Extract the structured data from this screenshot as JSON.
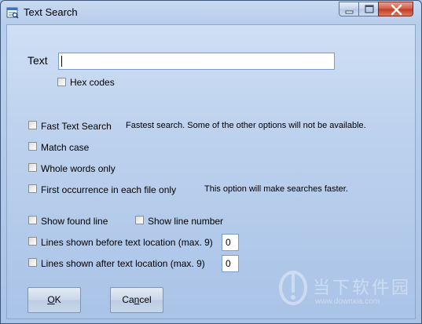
{
  "window": {
    "title": "Text Search",
    "controls": {
      "minimize_icon": "minimize-icon",
      "maximize_icon": "maximize-icon",
      "close_icon": "close-icon"
    },
    "close_color": "#c13b22"
  },
  "search": {
    "label": "Text",
    "value": "",
    "hex_codes": {
      "label": "Hex codes",
      "checked": false
    }
  },
  "options": {
    "fast_text_search": {
      "label": "Fast Text Search",
      "checked": false,
      "hint": "Fastest search. Some of the other options will not be available."
    },
    "match_case": {
      "label": "Match case",
      "checked": false
    },
    "whole_words_only": {
      "label": "Whole words only",
      "checked": false
    },
    "first_occurrence": {
      "label": "First occurrence in each file only",
      "checked": false,
      "hint": "This option will make searches faster."
    }
  },
  "display": {
    "show_found_line": {
      "label": "Show found line",
      "checked": false
    },
    "show_line_number": {
      "label": "Show line number",
      "checked": false
    },
    "lines_before": {
      "label": "Lines shown before text location (max. 9)",
      "checked": false,
      "value": "0"
    },
    "lines_after": {
      "label": "Lines shown after text location (max. 9)",
      "checked": false,
      "value": "0"
    }
  },
  "buttons": {
    "ok_label": "OK",
    "ok_mnemonic": "O",
    "ok_rest": "K",
    "cancel_pre": "Ca",
    "cancel_mnemonic": "n",
    "cancel_rest": "cel"
  },
  "watermark": {
    "logo_icon": "downxia-logo-icon",
    "text": "当下软件园",
    "url": "www.downxia.com"
  }
}
